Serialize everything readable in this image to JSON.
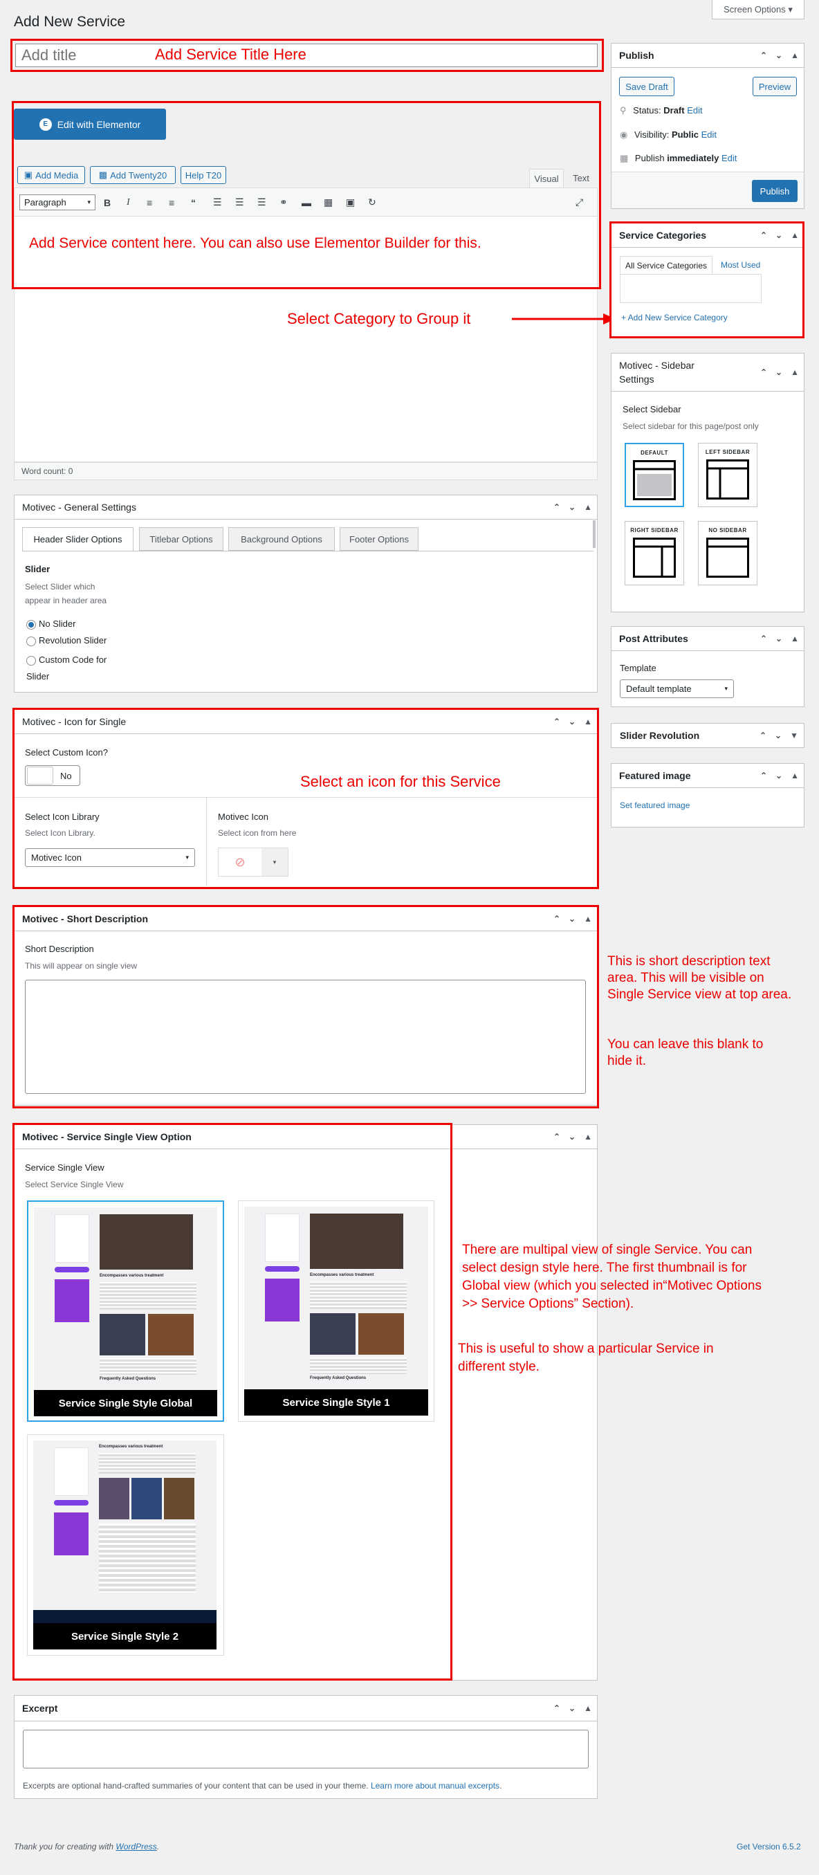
{
  "header": {
    "page_title": "Add New Service",
    "screen_options": "Screen Options ▾"
  },
  "title_field": {
    "placeholder": "Add title"
  },
  "editor": {
    "elementor_button": "Edit with Elementor",
    "media_buttons": [
      "Add Media",
      "Add Twenty20",
      "Help T20"
    ],
    "tabs": {
      "visual": "Visual",
      "text": "Text"
    },
    "format_select": "Paragraph",
    "word_count": "Word count: 0"
  },
  "annotations": {
    "title": "Add Service Title Here",
    "content": "Add Service content here. You can also use Elementor Builder for this.",
    "category": "Select Category to Group it",
    "icon": "Select an icon for this Service",
    "short_desc_1": "This is short description text area. This will be visible on Single Service view at top area.",
    "short_desc_2": "You can leave this blank to hide it.",
    "single_view_1": "There are multipal view of single Service. You can select design style here. The first thumbnail is for Global view (which you selected in“Motivec Options >> Service Options” Section).",
    "single_view_2": "This is useful to show a particular Service in different style."
  },
  "general_settings": {
    "title": "Motivec - General Settings",
    "tabs": [
      "Header Slider Options",
      "Titlebar Options",
      "Background Options",
      "Footer Options"
    ],
    "slider_label": "Slider",
    "slider_desc": "Select Slider which appear in header area",
    "options": [
      "No Slider",
      "Revolution Slider",
      "Custom Code for Slider"
    ]
  },
  "icon_single": {
    "title": "Motivec - Icon for Single",
    "custom_label": "Select Custom Icon?",
    "toggle_value": "No",
    "library_label": "Select Icon Library",
    "library_desc": "Select Icon Library.",
    "library_value": "Motivec Icon",
    "icon_label": "Motivec Icon",
    "icon_desc": "Select icon from here"
  },
  "short_description": {
    "title": "Motivec - Short Description",
    "label": "Short Description",
    "desc": "This will appear on single view"
  },
  "single_view": {
    "title": "Motivec - Service Single View Option",
    "label": "Service Single View",
    "desc": "Select Service Single View",
    "styles": [
      "Service Single Style Global",
      "Service Single Style 1",
      "Service Single Style 2"
    ],
    "mock_heading": "Encompasses various treatment",
    "mock_faq": "Frequently Asked Questions"
  },
  "excerpt": {
    "title": "Excerpt",
    "help": "Excerpts are optional hand-crafted summaries of your content that can be used in your theme.",
    "help_link": "Learn more about manual excerpts"
  },
  "publish": {
    "title": "Publish",
    "save_draft": "Save Draft",
    "preview": "Preview",
    "status_label": "Status:",
    "status_value": "Draft",
    "visibility_label": "Visibility:",
    "visibility_value": "Public",
    "publish_label": "Publish",
    "publish_value": "immediately",
    "edit": "Edit",
    "publish_button": "Publish"
  },
  "categories": {
    "title": "Service Categories",
    "tab_all": "All Service Categories",
    "tab_most": "Most Used",
    "add_new": "+ Add New Service Category"
  },
  "sidebar_settings": {
    "title": "Motivec - Sidebar Settings",
    "label": "Select Sidebar",
    "desc": "Select sidebar for this page/post only",
    "layouts": [
      "DEFAULT",
      "LEFT SIDEBAR",
      "RIGHT SIDEBAR",
      "NO SIDEBAR"
    ]
  },
  "post_attributes": {
    "title": "Post Attributes",
    "template_label": "Template",
    "template_value": "Default template"
  },
  "slider_revolution": {
    "title": "Slider Revolution"
  },
  "featured_image": {
    "title": "Featured image",
    "link": "Set featured image"
  },
  "footer": {
    "thanks": "Thank you for creating with",
    "wp": "WordPress",
    "version": "Get Version 6.5.2"
  },
  "colors": {
    "annotation": "#ee0000",
    "wp_blue": "#2271b1",
    "selected_outline": "#2ea2e8"
  }
}
